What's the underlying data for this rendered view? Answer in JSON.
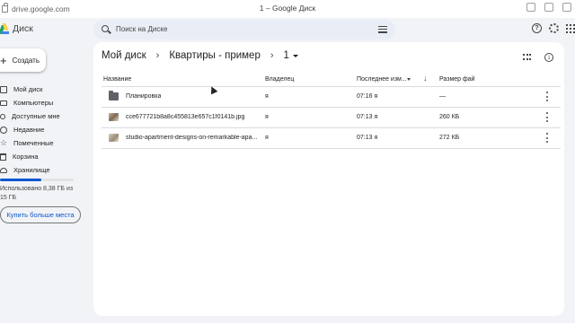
{
  "browser": {
    "url": "drive.google.com",
    "tab_title": "1 – Google Диск"
  },
  "app": {
    "logo_text": "Диск"
  },
  "search": {
    "placeholder": "Поиск на Диске"
  },
  "sidebar": {
    "create_label": "Создать",
    "items": [
      {
        "label": "Мой диск",
        "icon": "my-drive-icon"
      },
      {
        "label": "Компьютеры",
        "icon": "computer-icon"
      },
      {
        "label": "Доступные мне",
        "icon": "shared-icon"
      },
      {
        "label": "Недавние",
        "icon": "clock-icon"
      },
      {
        "label": "Помеченные",
        "icon": "star-icon"
      },
      {
        "label": "Корзина",
        "icon": "trash-icon"
      },
      {
        "label": "Хранилище",
        "icon": "cloud-icon"
      }
    ],
    "storage_text": "Использовано 8,38 ГБ из 15 ГБ",
    "storage_used_fraction": 0.56,
    "buy_storage_label": "Купить больше места"
  },
  "breadcrumb": {
    "items": [
      "Мой диск",
      "Квартиры - пример",
      "1"
    ],
    "separator": "›"
  },
  "table": {
    "columns": {
      "name": "Название",
      "owner": "Владелец",
      "modified": "Последнее изм...",
      "size": "Размер фай"
    },
    "rows": [
      {
        "type": "folder",
        "name": "Планировка",
        "owner": "я",
        "modified": "07:16 я",
        "size": "—"
      },
      {
        "type": "image",
        "name": "cce677721b8a8c455813e657c1f0141b.jpg",
        "owner": "я",
        "modified": "07:13 я",
        "size": "260 КБ"
      },
      {
        "type": "image",
        "name": "studio-apartment-designs-on-remarkable-apa...",
        "owner": "я",
        "modified": "07:13 я",
        "size": "272 КБ"
      }
    ]
  },
  "colors": {
    "accent": "#0b57d0",
    "background": "#f1f3f6",
    "panel": "#ffffff"
  }
}
